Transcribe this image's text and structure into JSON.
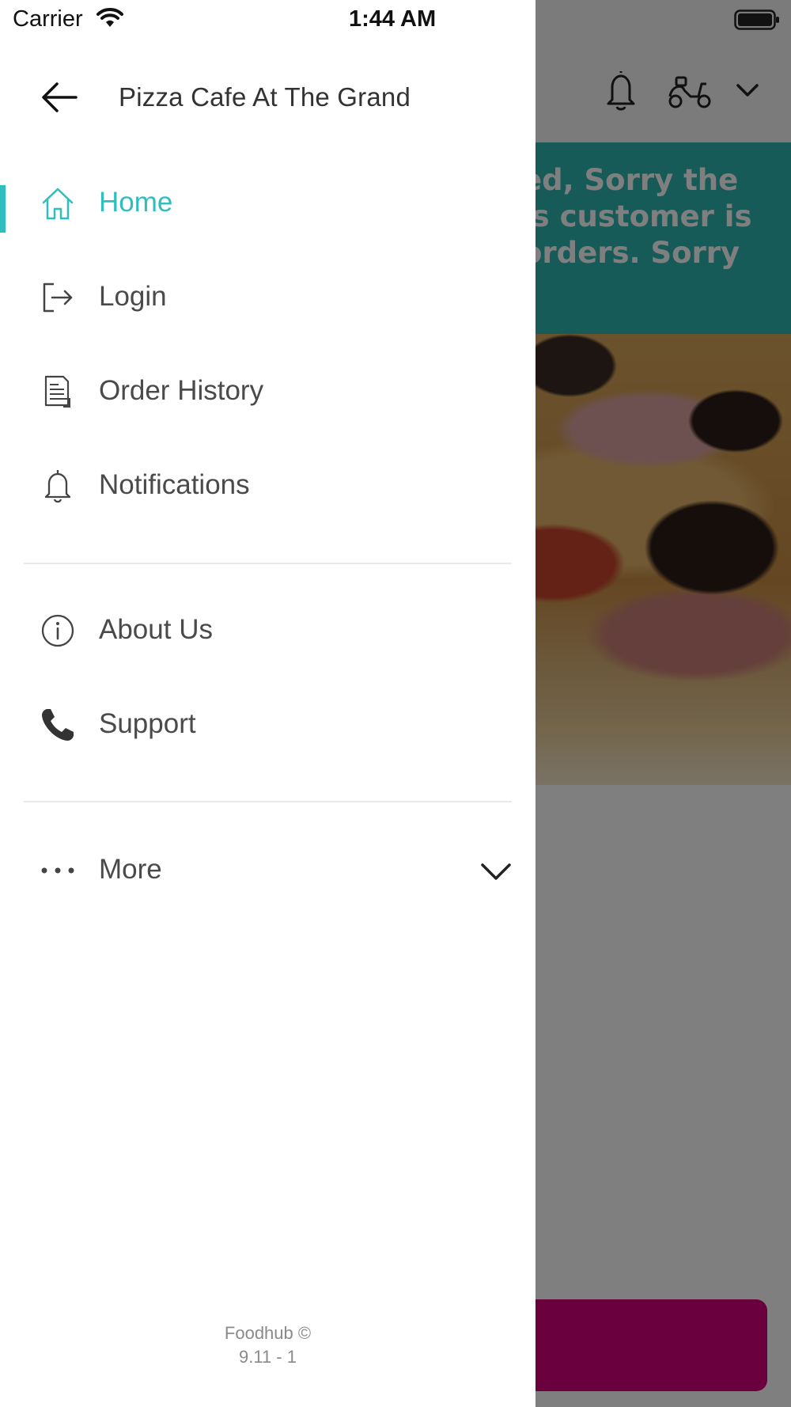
{
  "status_bar": {
    "carrier": "Carrier",
    "time": "1:44 AM",
    "wifi_icon": "wifi-icon",
    "battery_icon": "battery-icon"
  },
  "background": {
    "banner_text": "ed, Sorry the\nis customer is\norders. Sorry",
    "banner_color": "#2fb7b0",
    "bottom_button_color": "#d4007a",
    "header_icons": [
      "bell-icon",
      "scooter-icon",
      "chevron-down-icon"
    ]
  },
  "drawer": {
    "store_name": "Pizza Cafe At The Grand",
    "accent_color": "#2fbdbd",
    "items": [
      {
        "label": "Home",
        "icon": "home-icon",
        "active": true
      },
      {
        "label": "Login",
        "icon": "login-icon",
        "active": false
      },
      {
        "label": "Order History",
        "icon": "receipt-icon",
        "active": false
      },
      {
        "label": "Notifications",
        "icon": "bell-icon",
        "active": false
      }
    ],
    "secondary_items": [
      {
        "label": "About Us",
        "icon": "info-icon"
      },
      {
        "label": "Support",
        "icon": "phone-icon"
      }
    ],
    "more": {
      "label": "More",
      "icon": "more-dots-icon",
      "chevron": "chevron-down-icon"
    },
    "footer": {
      "brand": "Foodhub ©",
      "version": "9.11 - 1"
    }
  }
}
